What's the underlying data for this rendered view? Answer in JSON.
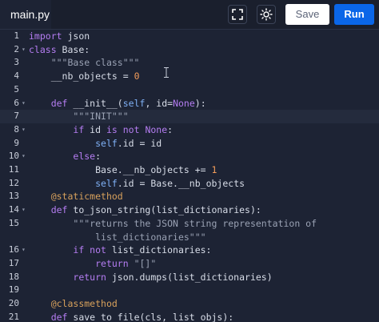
{
  "tab": {
    "filename": "main.py"
  },
  "toolbar": {
    "fullscreen_icon": "fullscreen-icon",
    "theme_icon": "sun-icon",
    "save_label": "Save",
    "run_label": "Run"
  },
  "colors": {
    "background": "#1d2334",
    "run_button": "#0a66e8",
    "keyword": "#b57df2",
    "string": "#9aa2b4",
    "number": "#f39c5a"
  },
  "editor": {
    "lines": [
      {
        "n": "1",
        "fold": "",
        "parts": [
          [
            "kw",
            "import"
          ],
          [
            "t",
            " json"
          ]
        ]
      },
      {
        "n": "2",
        "fold": "▾",
        "parts": [
          [
            "kw",
            "class"
          ],
          [
            "t",
            " Base:"
          ]
        ]
      },
      {
        "n": "3",
        "fold": "",
        "parts": [
          [
            "t",
            "    "
          ],
          [
            "str",
            "\"\"\"Base class\"\"\""
          ]
        ]
      },
      {
        "n": "4",
        "fold": "",
        "parts": [
          [
            "t",
            "    __nb_objects = "
          ],
          [
            "num",
            "0"
          ]
        ]
      },
      {
        "n": "5",
        "fold": "",
        "parts": []
      },
      {
        "n": "6",
        "fold": "▾",
        "parts": [
          [
            "t",
            "    "
          ],
          [
            "kw",
            "def"
          ],
          [
            "t",
            " __init__("
          ],
          [
            "self",
            "self"
          ],
          [
            "t",
            ", id="
          ],
          [
            "kw",
            "None"
          ],
          [
            "t",
            "):"
          ]
        ]
      },
      {
        "n": "7",
        "fold": "",
        "active": true,
        "parts": [
          [
            "t",
            "        "
          ],
          [
            "str",
            "\"\"\"INIT\"\"\""
          ]
        ]
      },
      {
        "n": "8",
        "fold": "▾",
        "parts": [
          [
            "t",
            "        "
          ],
          [
            "kw",
            "if"
          ],
          [
            "t",
            " id "
          ],
          [
            "kw",
            "is not"
          ],
          [
            "t",
            " "
          ],
          [
            "kw",
            "None"
          ],
          [
            "t",
            ":"
          ]
        ]
      },
      {
        "n": "9",
        "fold": "",
        "parts": [
          [
            "t",
            "            "
          ],
          [
            "self",
            "self"
          ],
          [
            "t",
            ".id = id"
          ]
        ]
      },
      {
        "n": "10",
        "fold": "▾",
        "parts": [
          [
            "t",
            "        "
          ],
          [
            "kw",
            "else"
          ],
          [
            "t",
            ":"
          ]
        ]
      },
      {
        "n": "11",
        "fold": "",
        "parts": [
          [
            "t",
            "            Base.__nb_objects += "
          ],
          [
            "num",
            "1"
          ]
        ]
      },
      {
        "n": "12",
        "fold": "",
        "parts": [
          [
            "t",
            "            "
          ],
          [
            "self",
            "self"
          ],
          [
            "t",
            ".id = Base.__nb_objects"
          ]
        ]
      },
      {
        "n": "13",
        "fold": "",
        "parts": [
          [
            "t",
            "    "
          ],
          [
            "deco",
            "@staticmethod"
          ]
        ]
      },
      {
        "n": "14",
        "fold": "▾",
        "parts": [
          [
            "t",
            "    "
          ],
          [
            "kw",
            "def"
          ],
          [
            "t",
            " to_json_string(list_dictionaries):"
          ]
        ]
      },
      {
        "n": "15",
        "fold": "",
        "parts": [
          [
            "t",
            "        "
          ],
          [
            "str",
            "\"\"\"returns the JSON string representation of"
          ]
        ]
      },
      {
        "n": "",
        "fold": "",
        "parts": [
          [
            "t",
            "            "
          ],
          [
            "str",
            "list_dictionaries\"\"\""
          ]
        ]
      },
      {
        "n": "16",
        "fold": "▾",
        "parts": [
          [
            "t",
            "        "
          ],
          [
            "kw",
            "if not"
          ],
          [
            "t",
            " list_dictionaries:"
          ]
        ]
      },
      {
        "n": "17",
        "fold": "",
        "parts": [
          [
            "t",
            "            "
          ],
          [
            "kw",
            "return"
          ],
          [
            "t",
            " "
          ],
          [
            "str",
            "\"[]\""
          ]
        ]
      },
      {
        "n": "18",
        "fold": "",
        "parts": [
          [
            "t",
            "        "
          ],
          [
            "kw",
            "return"
          ],
          [
            "t",
            " json.dumps(list_dictionaries)"
          ]
        ]
      },
      {
        "n": "19",
        "fold": "",
        "parts": []
      },
      {
        "n": "20",
        "fold": "",
        "parts": [
          [
            "t",
            "    "
          ],
          [
            "deco",
            "@classmethod"
          ]
        ]
      },
      {
        "n": "21",
        "fold": "",
        "parts": [
          [
            "t",
            "    "
          ],
          [
            "kw",
            "def"
          ],
          [
            "t",
            " save_to_file(cls, list_objs):"
          ]
        ]
      }
    ]
  }
}
